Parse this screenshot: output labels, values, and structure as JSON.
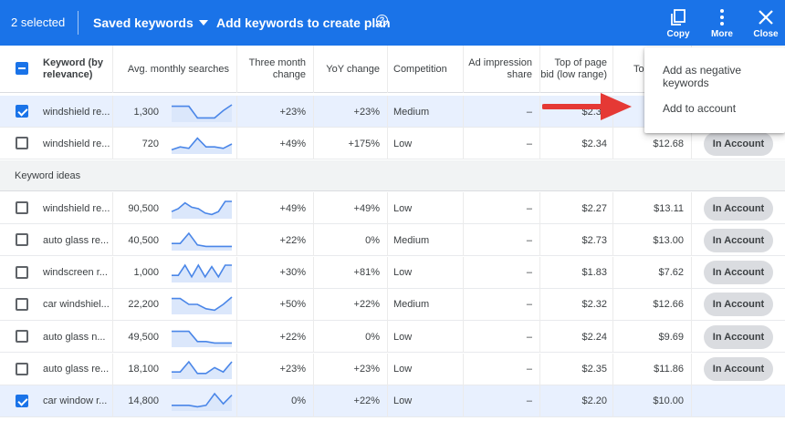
{
  "topbar": {
    "selected": "2 selected",
    "saved_keywords": "Saved keywords",
    "add_keywords": "Add keywords to create plan",
    "help_glyph": "?",
    "copy": "Copy",
    "more": "More",
    "close": "Close"
  },
  "columns": {
    "keyword": "Keyword (by relevance)",
    "avg": "Avg. monthly searches",
    "three_month": "Three month change",
    "yoy": "YoY change",
    "competition": "Competition",
    "ad_impr": "Ad impression share",
    "top_low": "Top of page bid (low range)",
    "top_high": "To"
  },
  "selected_rows": [
    {
      "keyword": "windshield re...",
      "avg": "1,300",
      "three": "+23%",
      "yoy": "+23%",
      "comp": "Medium",
      "impr": "–",
      "low": "$2.34",
      "high": "",
      "status": "",
      "checked": true,
      "trend": [
        0.9,
        0.9,
        0.9,
        0.1,
        0.1,
        0.1,
        0.6,
        1.0
      ]
    },
    {
      "keyword": "windshield re...",
      "avg": "720",
      "three": "+49%",
      "yoy": "+175%",
      "comp": "Low",
      "impr": "–",
      "low": "$2.34",
      "high": "$12.68",
      "status": "In Account",
      "checked": false,
      "trend": [
        0.1,
        0.3,
        0.2,
        0.9,
        0.3,
        0.3,
        0.2,
        0.5
      ]
    }
  ],
  "section_title": "Keyword ideas",
  "idea_rows": [
    {
      "keyword": "windshield re...",
      "avg": "90,500",
      "three": "+49%",
      "yoy": "+49%",
      "comp": "Low",
      "impr": "–",
      "low": "$2.27",
      "high": "$13.11",
      "status": "In Account",
      "checked": false,
      "trend": [
        0.3,
        0.5,
        0.9,
        0.6,
        0.5,
        0.2,
        0.1,
        0.3,
        1.0,
        1.0
      ]
    },
    {
      "keyword": "auto glass re...",
      "avg": "40,500",
      "three": "+22%",
      "yoy": "0%",
      "comp": "Medium",
      "impr": "–",
      "low": "$2.73",
      "high": "$13.00",
      "status": "In Account",
      "checked": false,
      "trend": [
        0.3,
        0.3,
        1.0,
        0.2,
        0.1,
        0.1,
        0.1,
        0.1
      ]
    },
    {
      "keyword": "windscreen r...",
      "avg": "1,000",
      "three": "+30%",
      "yoy": "+81%",
      "comp": "Low",
      "impr": "–",
      "low": "$1.83",
      "high": "$7.62",
      "status": "In Account",
      "checked": false,
      "trend": [
        0.3,
        0.3,
        1.0,
        0.2,
        1.0,
        0.2,
        0.9,
        0.2,
        1.0,
        1.0
      ]
    },
    {
      "keyword": "car windshiel...",
      "avg": "22,200",
      "three": "+50%",
      "yoy": "+22%",
      "comp": "Medium",
      "impr": "–",
      "low": "$2.32",
      "high": "$12.66",
      "status": "In Account",
      "checked": false,
      "trend": [
        0.9,
        0.9,
        0.5,
        0.5,
        0.2,
        0.1,
        0.5,
        1.0
      ]
    },
    {
      "keyword": "auto glass n...",
      "avg": "49,500",
      "three": "+22%",
      "yoy": "0%",
      "comp": "Low",
      "impr": "–",
      "low": "$2.24",
      "high": "$9.69",
      "status": "In Account",
      "checked": false,
      "trend": [
        0.9,
        0.9,
        0.9,
        0.2,
        0.2,
        0.1,
        0.1,
        0.1
      ]
    },
    {
      "keyword": "auto glass re...",
      "avg": "18,100",
      "three": "+23%",
      "yoy": "+23%",
      "comp": "Low",
      "impr": "–",
      "low": "$2.35",
      "high": "$11.86",
      "status": "In Account",
      "checked": false,
      "trend": [
        0.3,
        0.3,
        1.0,
        0.2,
        0.2,
        0.6,
        0.3,
        1.0
      ]
    },
    {
      "keyword": "car window r...",
      "avg": "14,800",
      "three": "0%",
      "yoy": "+22%",
      "comp": "Low",
      "impr": "–",
      "low": "$2.20",
      "high": "$10.00",
      "status": "",
      "checked": true,
      "trend": [
        0.2,
        0.2,
        0.2,
        0.1,
        0.2,
        1.0,
        0.3,
        0.9
      ]
    }
  ],
  "menu": {
    "negative": "Add as negative keywords",
    "add_account": "Add to account"
  },
  "colors": {
    "accent": "#1a73e8",
    "arrow": "#e53935",
    "sparkline": "#4a86e8"
  }
}
